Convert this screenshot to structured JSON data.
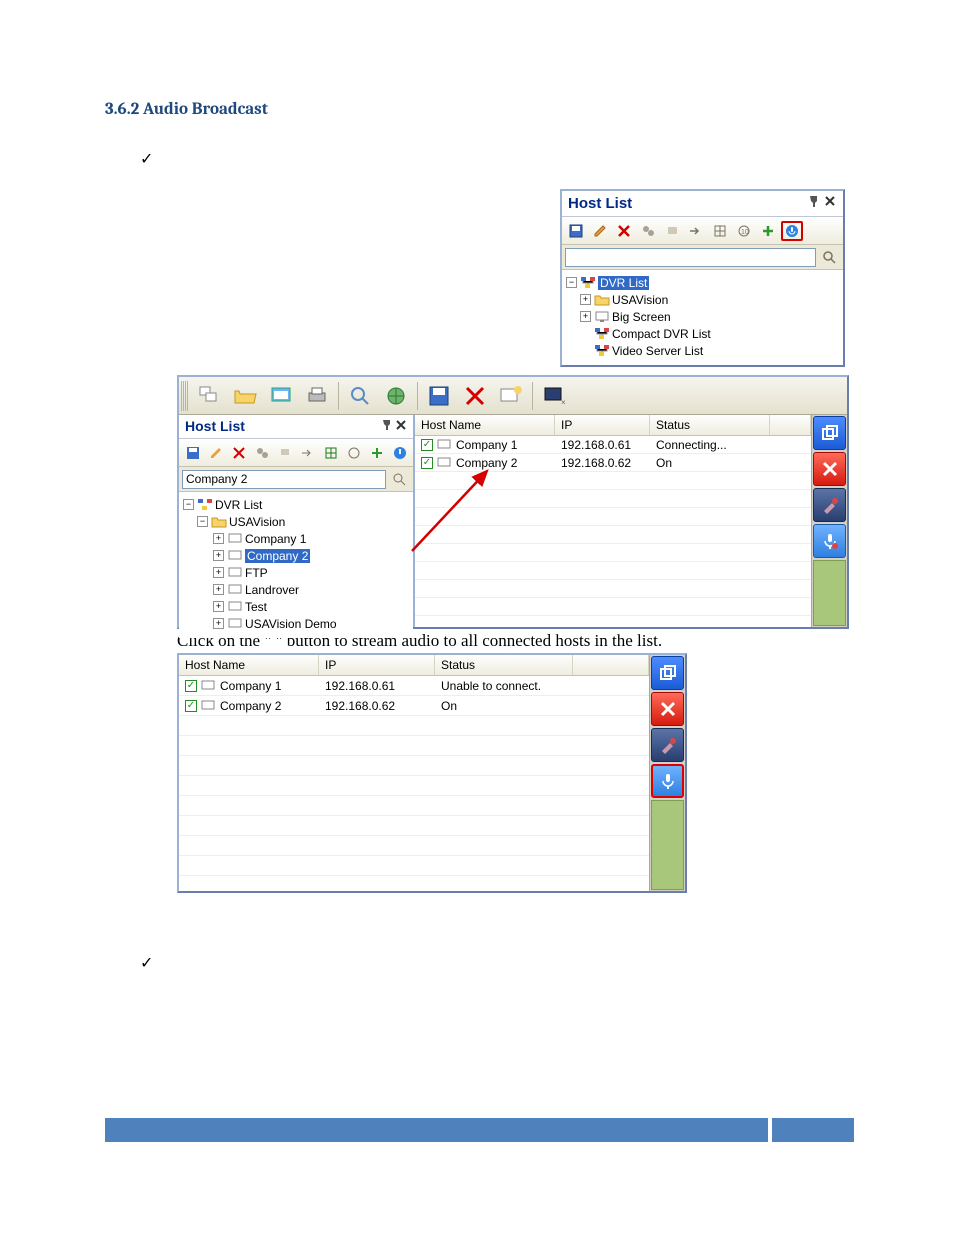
{
  "heading": "3.6.2 Audio Broadcast",
  "check_glyph": "✓",
  "panel1": {
    "title": "Host List",
    "search_value": "",
    "tree": {
      "root": "DVR List",
      "children": [
        {
          "label": "USAVision",
          "icon": "folder"
        },
        {
          "label": "Big Screen",
          "icon": "monitor"
        },
        {
          "label": "Compact DVR List",
          "icon": "network"
        },
        {
          "label": "Video Server List",
          "icon": "network"
        }
      ]
    }
  },
  "fig2": {
    "left": {
      "title": "Host List",
      "search_value": "Company 2",
      "tree": {
        "root": "DVR List",
        "folder": "USAVision",
        "items": [
          "Company 1",
          "Company 2",
          "FTP",
          "Landrover",
          "Test",
          "USAVision Demo"
        ],
        "selected_index": 1
      }
    },
    "right": {
      "columns": [
        "Host Name",
        "IP",
        "Status"
      ],
      "rows": [
        {
          "name": "Company 1",
          "ip": "192.168.0.61",
          "status": "Connecting..."
        },
        {
          "name": "Company 2",
          "ip": "192.168.0.62",
          "status": "On"
        }
      ]
    }
  },
  "caption": "Click on the \"        \" button to stream audio to all connected hosts in the list.",
  "fig3": {
    "columns": [
      "Host Name",
      "IP",
      "Status"
    ],
    "rows": [
      {
        "name": "Company 1",
        "ip": "192.168.0.61",
        "status": "Unable to connect."
      },
      {
        "name": "Company 2",
        "ip": "192.168.0.62",
        "status": "On"
      }
    ]
  }
}
